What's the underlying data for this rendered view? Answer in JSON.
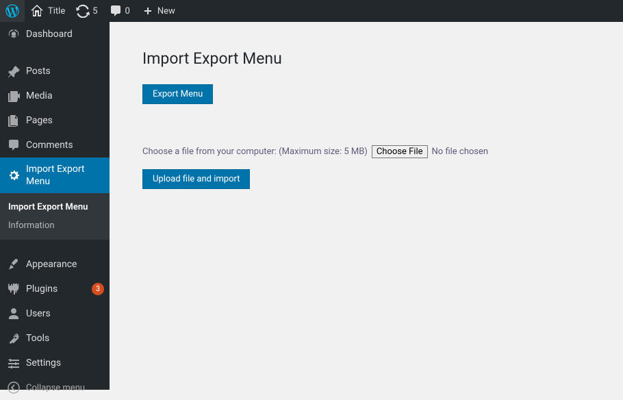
{
  "topbar": {
    "site_title": "Title",
    "updates": "5",
    "comments": "0",
    "new_label": "New"
  },
  "sidebar": {
    "items": [
      {
        "label": "Dashboard"
      },
      {
        "label": "Posts"
      },
      {
        "label": "Media"
      },
      {
        "label": "Pages"
      },
      {
        "label": "Comments"
      },
      {
        "label": "Import Export Menu"
      },
      {
        "label": "Appearance"
      },
      {
        "label": "Plugins",
        "badge": "3"
      },
      {
        "label": "Users"
      },
      {
        "label": "Tools"
      },
      {
        "label": "Settings"
      }
    ],
    "submenu": {
      "items": [
        {
          "label": "Import Export Menu"
        },
        {
          "label": "Information"
        }
      ]
    },
    "collapse_label": "Collapse menu"
  },
  "main": {
    "heading": "Import Export Menu",
    "export_btn": "Export Menu",
    "choose_text": "Choose a file from your computer: (Maximum size: 5 MB)",
    "choose_file_btn": "Choose File",
    "no_file_text": "No file chosen",
    "upload_btn": "Upload file and import"
  }
}
